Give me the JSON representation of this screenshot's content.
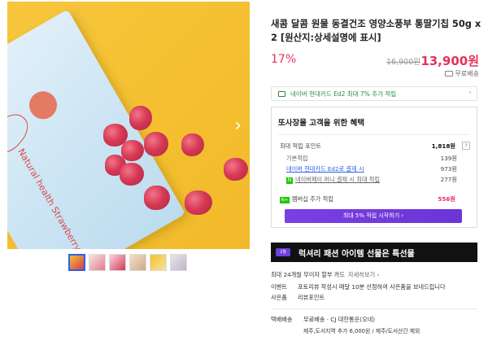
{
  "product": {
    "title": "새콤 달콤 원물 동결건조 영양소풍부 통딸기칩 50g x 2 [원산지:상세설명에 표시]",
    "pouch_text": "Natural health Strawberry Chips",
    "discount": "17%",
    "original_price": "16,900원",
    "sale_price": "13,900원",
    "shipping": "무료배송"
  },
  "card_banner": {
    "text": "네이버 현대카드 Ed2 최대 7% 추가 적립"
  },
  "benefits": {
    "title": "또사장몰 고객을 위한 혜택",
    "max_points_label": "최대 적립 포인트",
    "max_points_value": "1,818원",
    "help": "?",
    "basic_label": "기본적립",
    "basic_value": "139원",
    "card_label": "네이버 현대카드 Ed2로 결제 시",
    "card_value": "973원",
    "npay_badge": "N",
    "npay_label": "네이버페이 머니 결제 시 최대 적립",
    "npay_value": "277원",
    "member_badge": "N+",
    "member_label": "멤버십 추가 적립",
    "member_value": "556원",
    "cta_button": "최대 5% 적립 시작하기 ›"
  },
  "lux_banner": {
    "badge": "2월",
    "text": "럭셔리 패션 아이템 선물은 특선물"
  },
  "info": {
    "installment": "최대 24개월 무이자 할부 카드",
    "installment_more": "자세히보기 ›",
    "event_label": "이벤트",
    "event_text": "포토리뷰 작성시 매달 10분 선정하여 사은품을 보내드립니다",
    "gift_label": "사은품",
    "gift_text": "리뷰포인트",
    "delivery_label": "택배배송",
    "delivery_text": "무료배송 · CJ 대한통운(오네)",
    "delivery_sub": "제주,도서지역 추가 6,000원 / 제주/도서산간 제외"
  },
  "colors": {
    "accent_red": "#e5335a",
    "purple": "#6b35d6",
    "green": "#1ec800"
  }
}
